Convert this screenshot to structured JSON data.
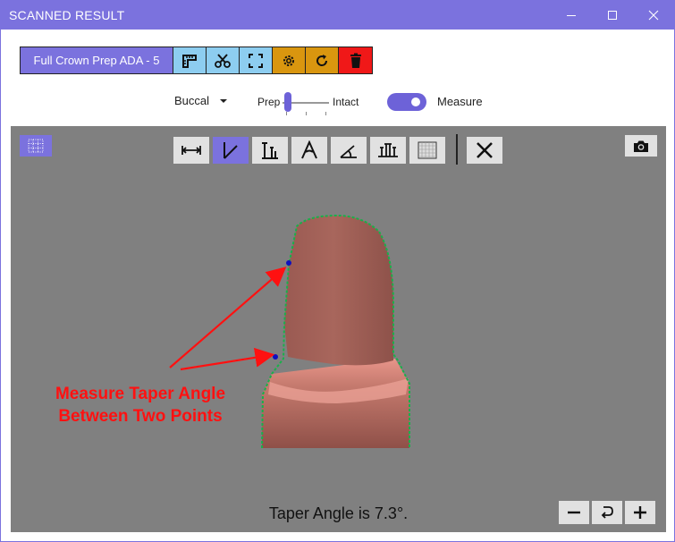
{
  "window": {
    "title": "SCANNED RESULT",
    "controls": [
      "minimize-icon",
      "maximize-icon",
      "close-icon"
    ],
    "accent_color": "#7b72de"
  },
  "procedure_toolbar": {
    "name": "Full Crown Prep ADA - 5",
    "buttons": [
      {
        "icon": "ruler-icon",
        "color": "#8dcdf0"
      },
      {
        "icon": "scissors-icon",
        "color": "#8dcdf0"
      },
      {
        "icon": "fit-frame-icon",
        "color": "#8dcdf0"
      },
      {
        "icon": "gear-icon",
        "color": "#d9960f"
      },
      {
        "icon": "refresh-icon",
        "color": "#d9960f"
      },
      {
        "icon": "trash-icon",
        "color": "#f01818"
      }
    ]
  },
  "view_controls": {
    "view_select": {
      "value": "Buccal",
      "icon": "caret-down-icon"
    },
    "blend_slider": {
      "left_label": "Prep",
      "right_label": "Intact",
      "value": 0.1
    },
    "measure_toggle": {
      "label": "Measure",
      "on": true
    }
  },
  "viewport": {
    "background": "#808080",
    "grid_toggle_icon": "dotted-grid-icon",
    "measure_tools": [
      {
        "icon": "distance-icon",
        "active": false
      },
      {
        "icon": "taper-angle-icon",
        "active": true
      },
      {
        "icon": "height-icon",
        "active": false
      },
      {
        "icon": "convergence-icon",
        "active": false
      },
      {
        "icon": "angle-icon",
        "active": false
      },
      {
        "icon": "profile-icon",
        "active": false
      },
      {
        "icon": "grid-icon",
        "active": false
      }
    ],
    "clear_icon": "close-icon",
    "camera_icon": "camera-icon",
    "annotation": {
      "line1": "Measure Taper Angle",
      "line2": "Between Two Points",
      "color": "#ff1111"
    },
    "result_text": "Taper Angle is 7.3°.",
    "zoom_controls": [
      "minus-icon",
      "reset-icon",
      "plus-icon"
    ]
  }
}
